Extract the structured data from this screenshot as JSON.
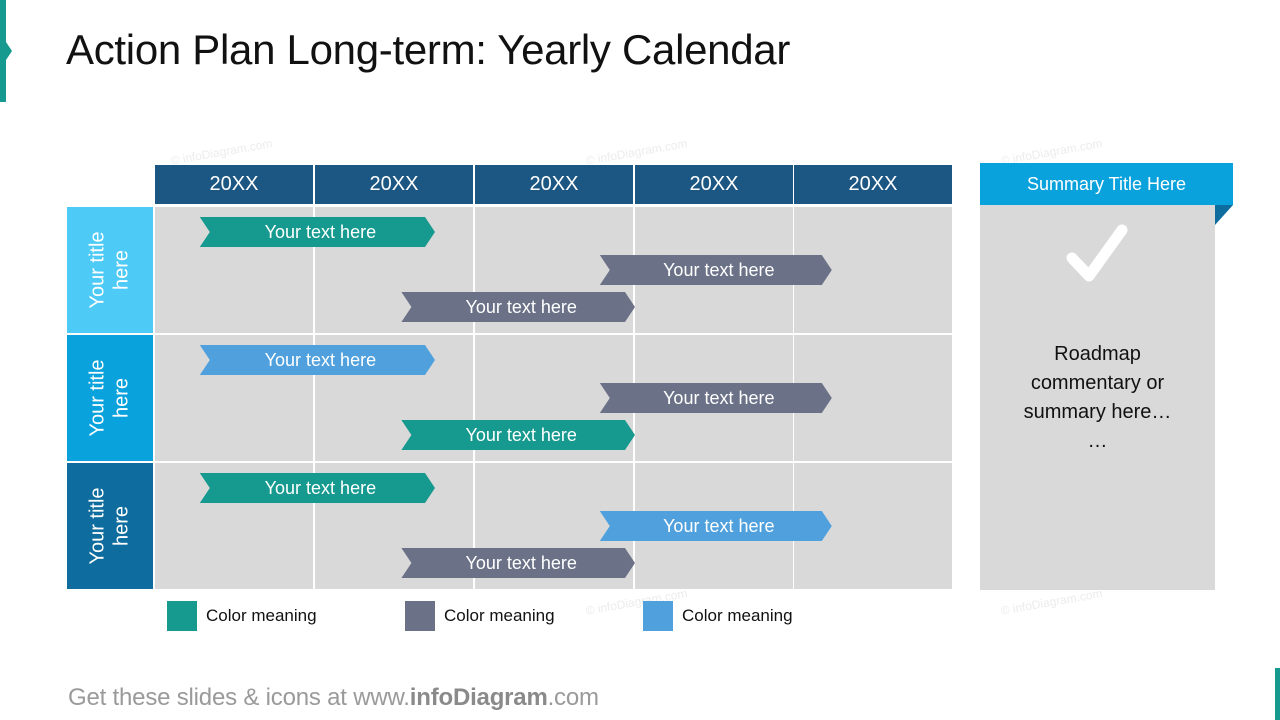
{
  "title": "Action Plan Long-term: Yearly Calendar",
  "colors": {
    "accent": "#16998e",
    "header_dark": "#1c5682",
    "row1": "#4dcaf6",
    "row2": "#0aa2dc",
    "row3": "#0e6d9e",
    "cell": "#d9d9d9",
    "teal": "#16998e",
    "slate": "#6b7287",
    "blue": "#4fa0dc"
  },
  "years": [
    "20XX",
    "20XX",
    "20XX",
    "20XX",
    "20XX"
  ],
  "rows": [
    {
      "title": "Your title\nhere",
      "bars": [
        {
          "label": "Your text here",
          "color": "teal",
          "start_col": 0.28,
          "end_col": 1.75,
          "lane": 0
        },
        {
          "label": "Your text here",
          "color": "slate",
          "start_col": 2.78,
          "end_col": 4.23,
          "lane": 1
        },
        {
          "label": "Your text here",
          "color": "slate",
          "start_col": 1.54,
          "end_col": 3.0,
          "lane": 2
        }
      ]
    },
    {
      "title": "Your title\nhere",
      "bars": [
        {
          "label": "Your text here",
          "color": "blue",
          "start_col": 0.28,
          "end_col": 1.75,
          "lane": 0
        },
        {
          "label": "Your text here",
          "color": "slate",
          "start_col": 2.78,
          "end_col": 4.23,
          "lane": 1
        },
        {
          "label": "Your text here",
          "color": "teal",
          "start_col": 1.54,
          "end_col": 3.0,
          "lane": 2
        }
      ]
    },
    {
      "title": "Your title\nhere",
      "bars": [
        {
          "label": "Your text here",
          "color": "teal",
          "start_col": 0.28,
          "end_col": 1.75,
          "lane": 0
        },
        {
          "label": "Your text here",
          "color": "blue",
          "start_col": 2.78,
          "end_col": 4.23,
          "lane": 1
        },
        {
          "label": "Your text here",
          "color": "slate",
          "start_col": 1.54,
          "end_col": 3.0,
          "lane": 2
        }
      ]
    }
  ],
  "summary": {
    "title": "Summary Title Here",
    "icon": "checkmark-icon",
    "text": "Roadmap\ncommentary or\nsummary here…\n…"
  },
  "legend": [
    {
      "color": "teal",
      "label": "Color meaning"
    },
    {
      "color": "slate",
      "label": "Color meaning"
    },
    {
      "color": "blue",
      "label": "Color meaning"
    }
  ],
  "footer": {
    "prefix": "Get these slides & icons at www.",
    "brand": "infoDiagram",
    "suffix": ".com"
  },
  "watermark": "© infoDiagram.com"
}
